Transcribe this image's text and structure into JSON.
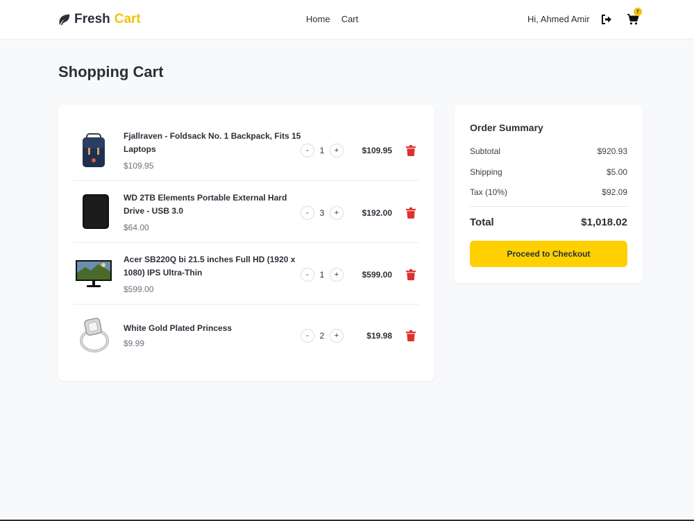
{
  "brand": {
    "word1": "Fresh",
    "word2": "Cart",
    "accent": "#f4c20d",
    "icon": "leaf-icon"
  },
  "nav": {
    "links": [
      "Home",
      "Cart"
    ],
    "greeting": "Hi, Ahmed Amir",
    "cart_count": "7",
    "logout_icon": "logout-icon",
    "cart_icon": "cart-icon"
  },
  "page": {
    "title": "Shopping Cart"
  },
  "cart": {
    "items": [
      {
        "title": "Fjallraven - Foldsack No. 1 Backpack, Fits 15 Laptops",
        "unit_price": "$109.95",
        "quantity": "1",
        "line_total": "$109.95",
        "image": "backpack"
      },
      {
        "title": "WD 2TB Elements Portable External Hard Drive - USB 3.0",
        "unit_price": "$64.00",
        "quantity": "3",
        "line_total": "$192.00",
        "image": "hard-drive"
      },
      {
        "title": "Acer SB220Q bi 21.5 inches Full HD (1920 x 1080) IPS Ultra-Thin",
        "unit_price": "$599.00",
        "quantity": "1",
        "line_total": "$599.00",
        "image": "monitor"
      },
      {
        "title": "White Gold Plated Princess",
        "unit_price": "$9.99",
        "quantity": "2",
        "line_total": "$19.98",
        "image": "ring"
      }
    ],
    "decrement_label": "-",
    "increment_label": "+",
    "delete_color": "#e03131"
  },
  "summary": {
    "title": "Order Summary",
    "subtotal_label": "Subtotal",
    "subtotal": "$920.93",
    "shipping_label": "Shipping",
    "shipping": "$5.00",
    "tax_label": "Tax (10%)",
    "tax": "$92.09",
    "total_label": "Total",
    "total": "$1,018.02",
    "checkout_label": "Proceed to Checkout",
    "button_color": "#ffd000"
  }
}
